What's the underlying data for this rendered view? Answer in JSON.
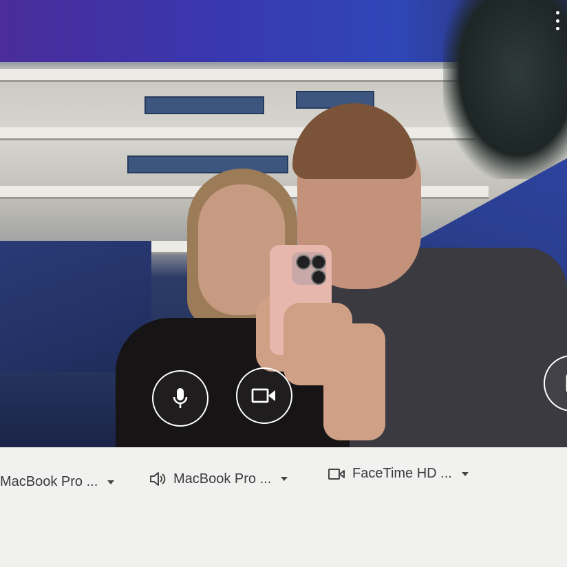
{
  "preview": {
    "menu_icon": "more-vert-icon",
    "mic_icon": "mic-icon",
    "camera_icon": "videocam-icon",
    "share_icon": "present-icon"
  },
  "devices": {
    "microphone": {
      "label": "MacBook Pro ...",
      "icon": "none"
    },
    "speaker": {
      "label": "MacBook Pro ...",
      "icon": "speaker-icon"
    },
    "camera": {
      "label": "FaceTime HD ...",
      "icon": "videocam-icon"
    }
  },
  "colors": {
    "button_border": "#ffffff",
    "text": "#3b3b3f",
    "background": "#f1f1ef"
  }
}
